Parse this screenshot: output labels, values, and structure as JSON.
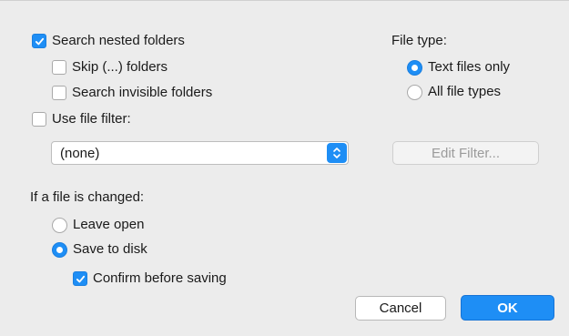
{
  "options": {
    "search_nested": {
      "label": "Search nested folders",
      "checked": true
    },
    "skip_folders": {
      "label": "Skip (...) folders",
      "checked": false
    },
    "search_invisible": {
      "label": "Search invisible folders",
      "checked": false
    },
    "use_file_filter": {
      "label": "Use file filter:",
      "checked": false
    }
  },
  "filter_select": {
    "value": "(none)"
  },
  "file_type": {
    "heading": "File type:",
    "text_only": {
      "label": "Text files only",
      "selected": true
    },
    "all_types": {
      "label": "All file types",
      "selected": false
    }
  },
  "edit_filter_label": "Edit Filter...",
  "changed": {
    "heading": "If a file is changed:",
    "leave_open": {
      "label": "Leave open",
      "selected": false
    },
    "save_to_disk": {
      "label": "Save to disk",
      "selected": true
    },
    "confirm": {
      "label": "Confirm before saving",
      "checked": true
    }
  },
  "buttons": {
    "cancel": "Cancel",
    "ok": "OK"
  },
  "colors": {
    "accent": "#1e8ef5",
    "background": "#ececec"
  }
}
